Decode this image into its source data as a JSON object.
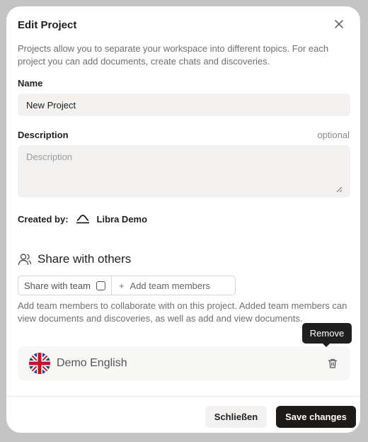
{
  "dialog": {
    "title": "Edit Project",
    "intro": "Projects allow you to separate your workspace into different topics. For each project you can add documents, create chats and discoveries."
  },
  "name_field": {
    "label": "Name",
    "value": "New Project"
  },
  "description_field": {
    "label": "Description",
    "optional_label": "optional",
    "placeholder": "Description"
  },
  "created_by": {
    "label": "Created by:",
    "creator": "Libra Demo"
  },
  "share": {
    "title": "Share with others",
    "team_toggle_label": "Share with team",
    "team_checked": false,
    "add_members_label": "Add team members",
    "help_text": "Add team members to collaborate with on this project. Added team members can view documents and discoveries, as well as add and view documents.",
    "members": [
      {
        "name": "Demo English",
        "flag_icon": "uk-flag-icon"
      }
    ],
    "tooltip": "Remove"
  },
  "footer": {
    "close_label": "Schließen",
    "save_label": "Save changes"
  },
  "colors": {
    "primary_button": "#1d1a17",
    "input_background": "#f2f1ef",
    "backdrop": "#c4c4c4"
  }
}
